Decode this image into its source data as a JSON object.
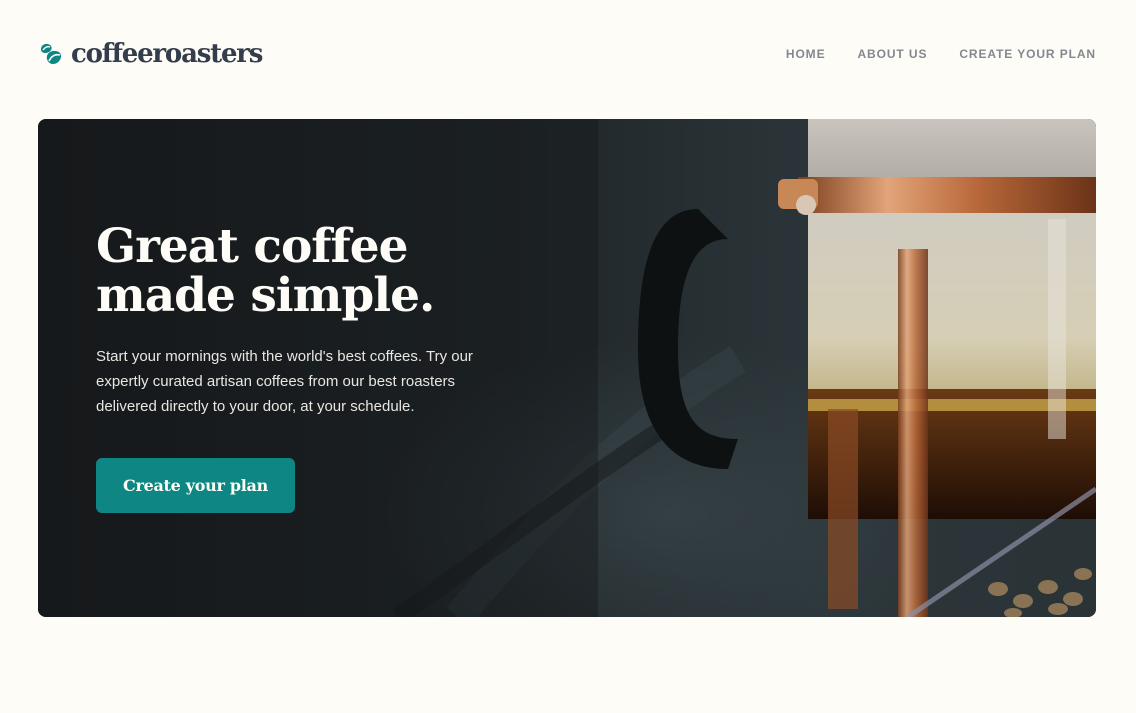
{
  "brand": {
    "name": "coffeeroasters",
    "accent_color": "#0E8784",
    "text_color": "#333D4B",
    "icon": "coffee-bean-icon"
  },
  "nav": {
    "items": [
      {
        "label": "HOME"
      },
      {
        "label": "ABOUT US"
      },
      {
        "label": "CREATE YOUR PLAN"
      }
    ]
  },
  "hero": {
    "title_line1": "Great coffee",
    "title_line2": "made simple.",
    "description": "Start your mornings with the world's best coffees. Try our expertly curated artisan coffees from our best roasters delivered directly to your door, at your schedule.",
    "cta_label": "Create your plan",
    "image": "french-press-coffee-photo"
  }
}
